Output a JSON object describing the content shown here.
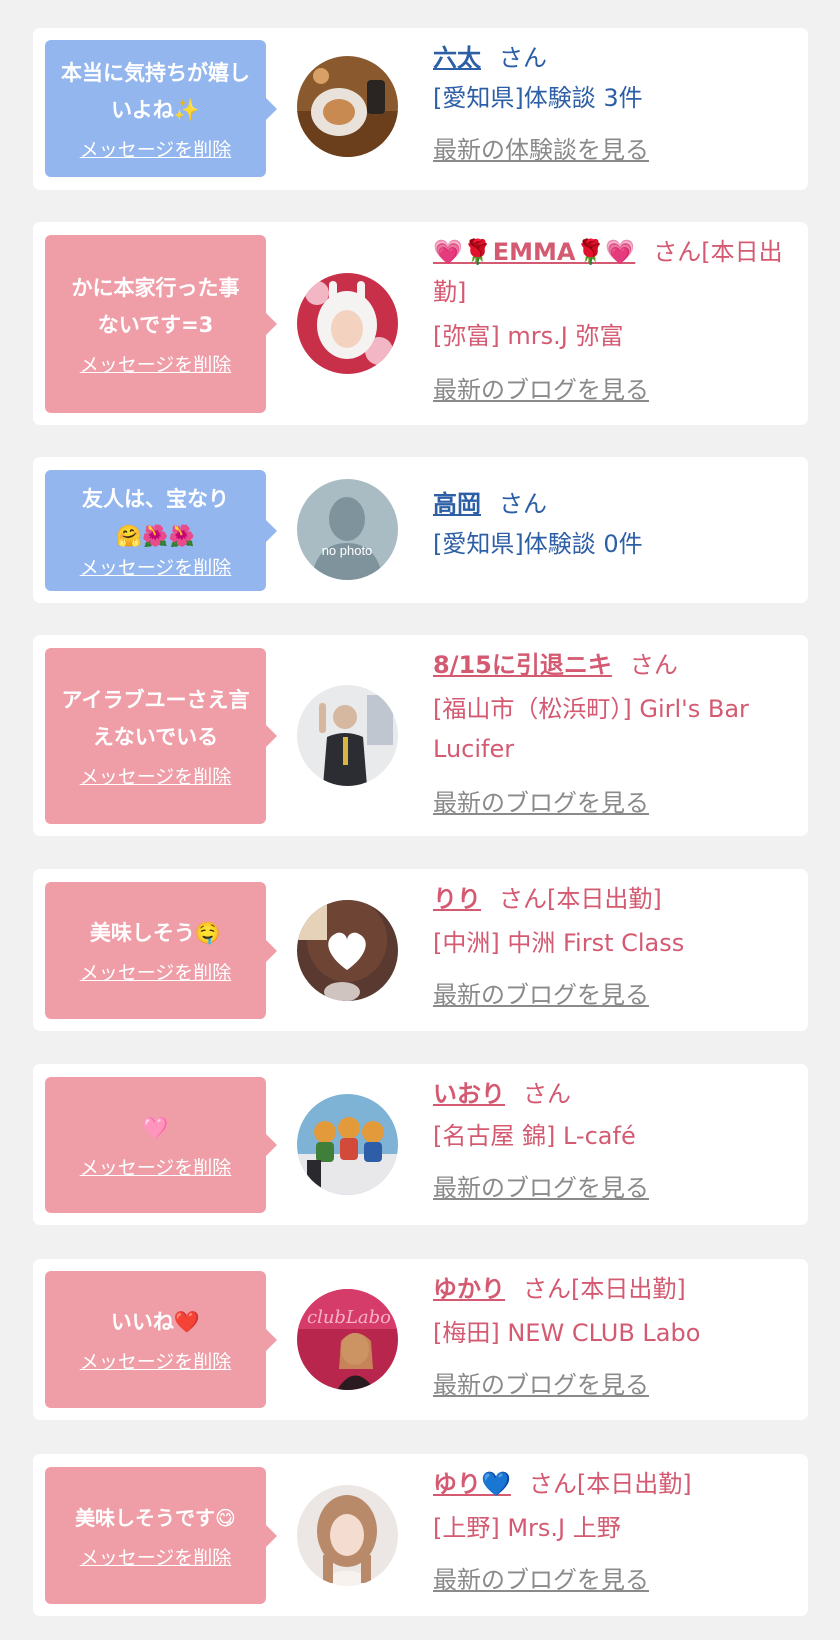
{
  "delete_label": "メッセージを削除",
  "colors": {
    "blue_bubble": "#93b6ee",
    "pink_bubble": "#ef9ea8",
    "blue_text": "#2d5fa6",
    "pink_text": "#d45a72",
    "link_gray": "#8a8a8a"
  },
  "messages": [
    {
      "message": "本当に気持ちが嬉しいよね✨",
      "name": "六太",
      "suffix": "さん",
      "shop": "[愛知県]体験談 3件",
      "link": "最新の体験談を見る",
      "avatar_icon": "food-plate-photo"
    },
    {
      "message": "かに本家行った事ないです=3",
      "name": "💗🌹EMMA🌹💗",
      "suffix": "さん[本日出勤]",
      "shop": "[弥富] mrs.J 弥富",
      "link": "最新のブログを見る",
      "avatar_icon": "woman-bunny-hood-photo"
    },
    {
      "message": "友人は、宝なり🤗🌺🌺",
      "name": "高岡",
      "suffix": "さん",
      "shop": "[愛知県]体験談 0件",
      "link": "",
      "avatar_icon": "no-photo-silhouette",
      "avatar_text": "no photo"
    },
    {
      "message": "アイラブユーさえ言えないでいる",
      "name": "8/15に引退ニキ",
      "suffix": "さん",
      "shop": "[福山市（松浜町）] Girl's Bar Lucifer",
      "link": "最新のブログを見る",
      "avatar_icon": "man-speech-photo"
    },
    {
      "message": "美味しそう🤤",
      "name": "りり",
      "suffix": "さん[本日出勤]",
      "shop": "[中洲] 中洲 First Class",
      "link": "最新のブログを見る",
      "avatar_icon": "woman-heart-face-photo"
    },
    {
      "message": "🩷",
      "name": "いおり",
      "suffix": "さん",
      "shop": "[名古屋 錦] L-café",
      "link": "最新のブログを見る",
      "avatar_icon": "figurines-photo"
    },
    {
      "message": "いいね❤️",
      "name": "ゆかり",
      "suffix": "さん[本日出勤]",
      "shop": "[梅田] NEW CLUB Labo",
      "link": "最新のブログを見る",
      "avatar_icon": "club-neon-photo"
    },
    {
      "message": "美味しそうです😋",
      "name": "ゆり💙",
      "suffix": "さん[本日出勤]",
      "shop": "[上野] Mrs.J 上野",
      "link": "最新のブログを見る",
      "avatar_icon": "woman-portrait-photo"
    }
  ]
}
